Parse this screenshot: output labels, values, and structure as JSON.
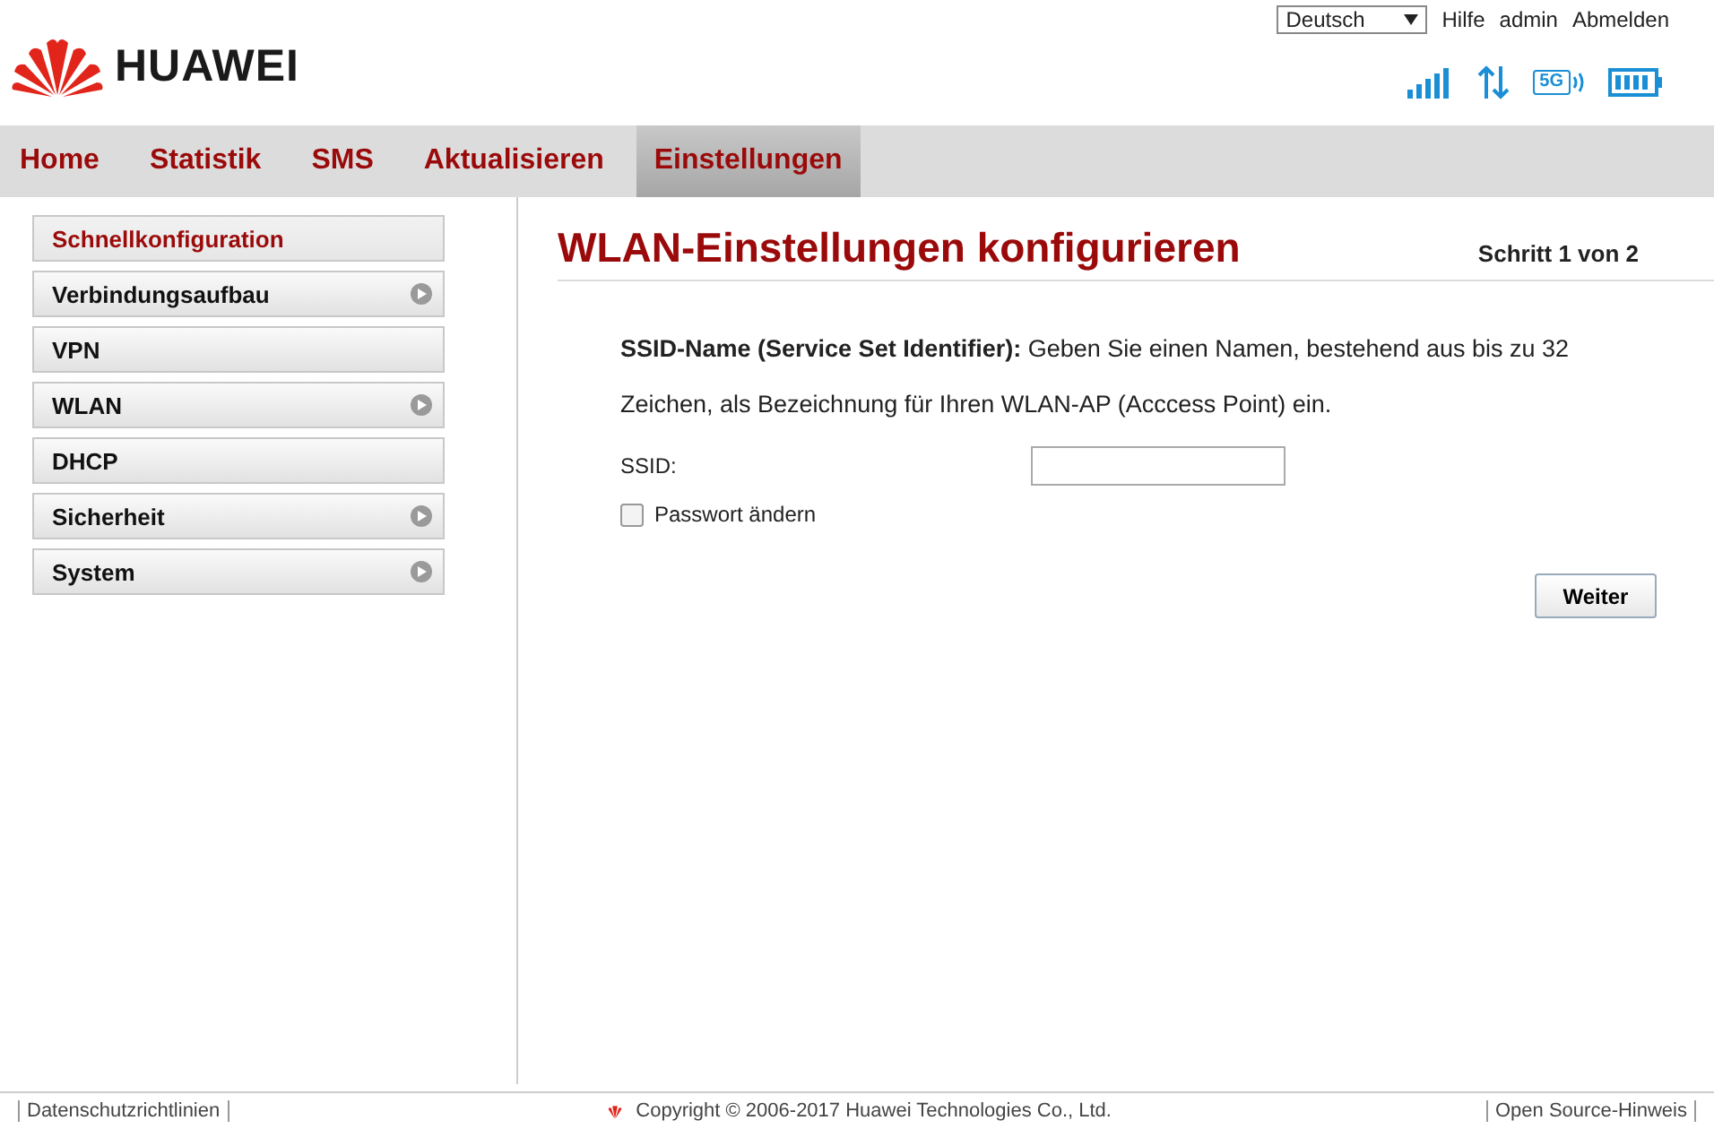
{
  "header": {
    "brand": "HUAWEI",
    "language": "Deutsch",
    "links": [
      "Hilfe",
      "admin",
      "Abmelden"
    ],
    "wifi_badge": "5G"
  },
  "tabs": [
    {
      "label": "Home",
      "selected": false
    },
    {
      "label": "Statistik",
      "selected": false
    },
    {
      "label": "SMS",
      "selected": false
    },
    {
      "label": "Aktualisieren",
      "selected": false
    },
    {
      "label": "Einstellungen",
      "selected": true
    }
  ],
  "sidebar": {
    "items": [
      {
        "label": "Schnellkonfiguration",
        "selected": true,
        "has_submenu": false
      },
      {
        "label": "Verbindungsaufbau",
        "selected": false,
        "has_submenu": true
      },
      {
        "label": "VPN",
        "selected": false,
        "has_submenu": false
      },
      {
        "label": "WLAN",
        "selected": false,
        "has_submenu": true
      },
      {
        "label": "DHCP",
        "selected": false,
        "has_submenu": false
      },
      {
        "label": "Sicherheit",
        "selected": false,
        "has_submenu": true
      },
      {
        "label": "System",
        "selected": false,
        "has_submenu": true
      }
    ]
  },
  "content": {
    "title": "WLAN-Einstellungen konfigurieren",
    "step": "Schritt 1 von 2",
    "description": "**SSID-Name (Service Set Identifier):**  Geben Sie einen Namen, bestehend aus bis zu 32 Zeichen, als Bezeichnung für Ihren WLAN-AP (Acccess Point) ein.",
    "ssid_label": "SSID:",
    "password_checkbox": {
      "label": "Passwort ändern",
      "checked": false
    },
    "next_button": "Weiter"
  },
  "footer": {
    "privacy": "Datenschutzrichtlinien",
    "copyright": "Copyright © 2006-2017 Huawei Technologies Co., Ltd.",
    "open_source": "Open Source-Hinweis"
  }
}
